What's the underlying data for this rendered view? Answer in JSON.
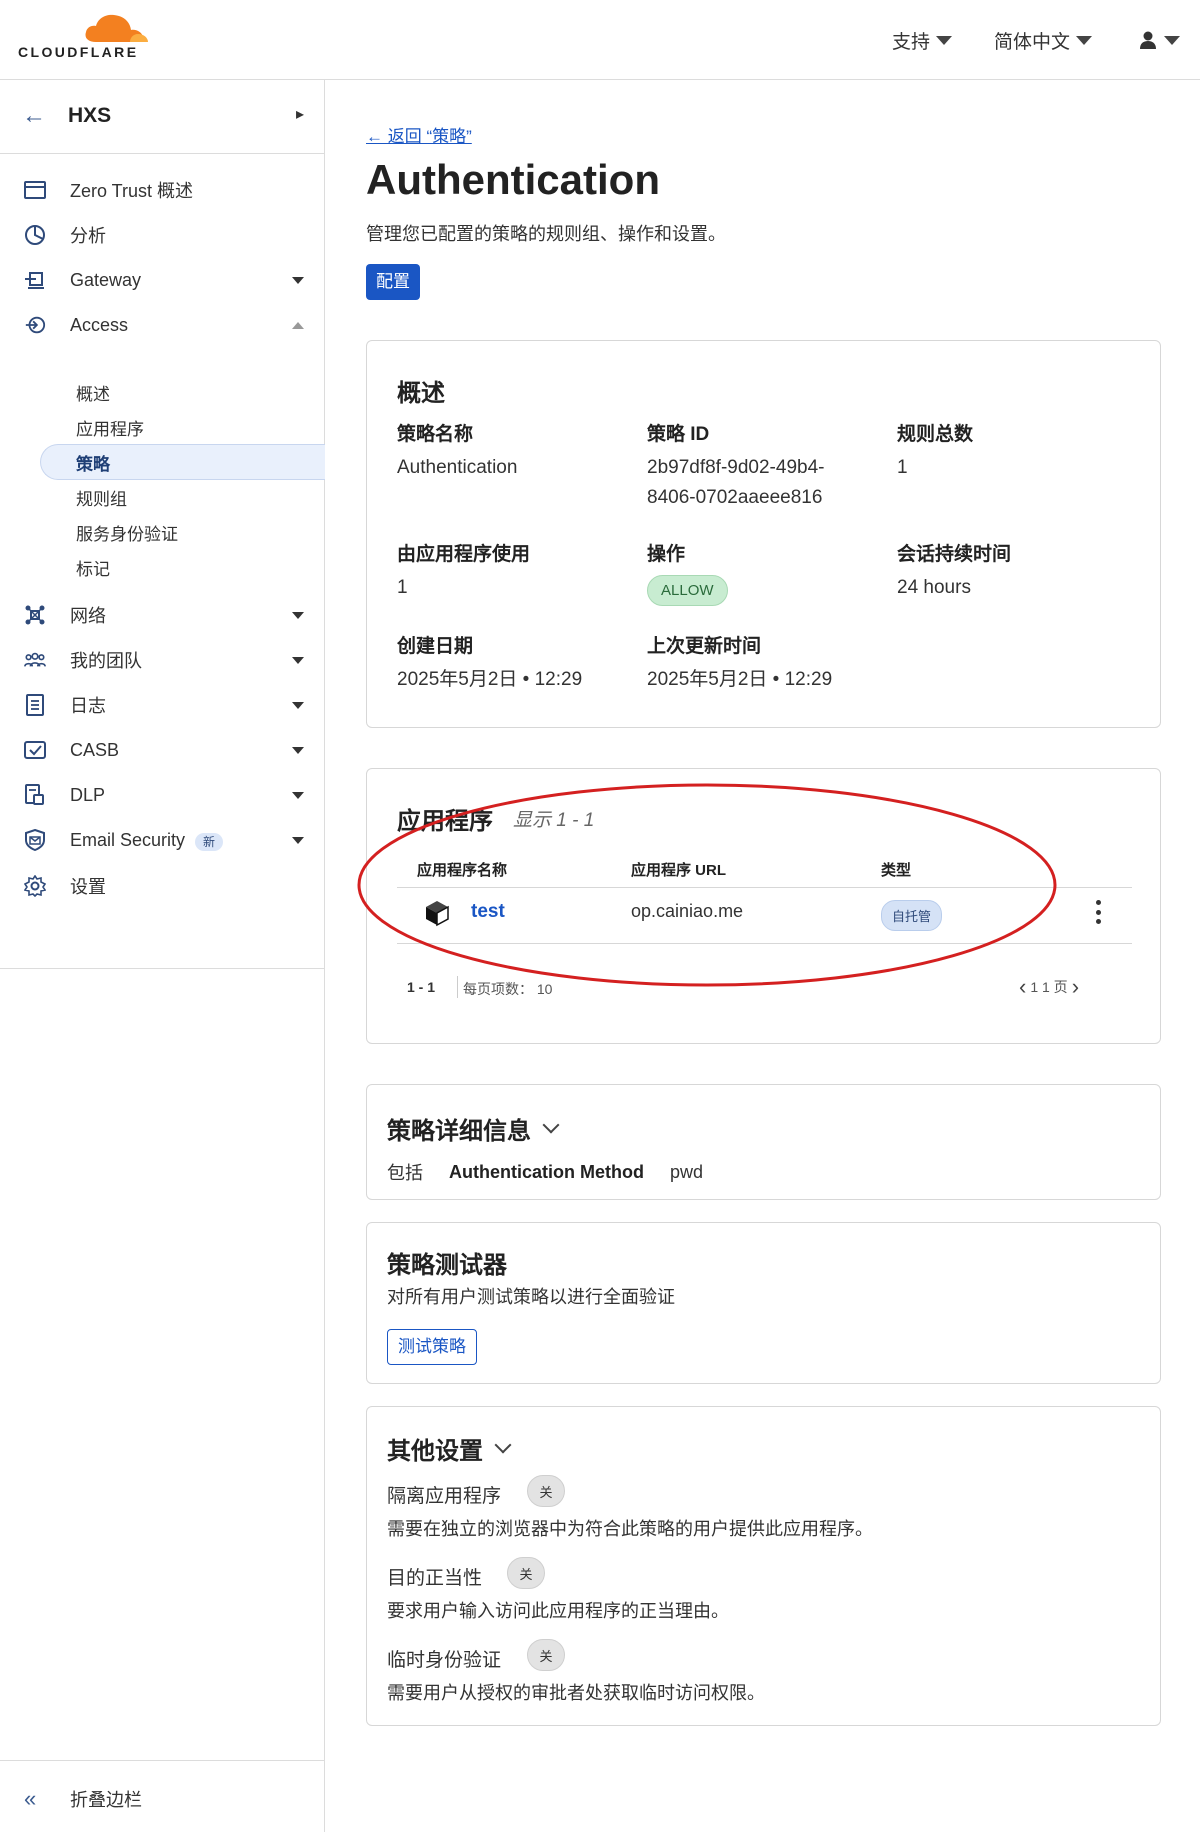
{
  "header": {
    "brand": "CLOUDFLARE",
    "support_label": "支持",
    "language_label": "简体中文"
  },
  "sidebar": {
    "account_name": "HXS",
    "items": [
      {
        "label": "Zero Trust 概述",
        "icon": "browser-window-icon"
      },
      {
        "label": "分析",
        "icon": "pie-chart-icon"
      },
      {
        "label": "Gateway",
        "icon": "gateway-icon"
      },
      {
        "label": "Access",
        "icon": "access-icon"
      },
      {
        "label": "网络",
        "icon": "network-icon"
      },
      {
        "label": "我的团队",
        "icon": "team-icon"
      },
      {
        "label": "日志",
        "icon": "logs-icon"
      },
      {
        "label": "CASB",
        "icon": "casb-icon"
      },
      {
        "label": "DLP",
        "icon": "dlp-icon"
      },
      {
        "label": "Email Security",
        "icon": "email-security-icon",
        "badge": "新"
      },
      {
        "label": "设置",
        "icon": "gear-icon"
      }
    ],
    "access_sub": [
      "概述",
      "应用程序",
      "策略",
      "规则组",
      "服务身份验证",
      "标记"
    ],
    "collapse_label": "折叠边栏"
  },
  "main": {
    "back_link": "← 返回 “策略”",
    "title": "Authentication",
    "description": "管理您已配置的策略的规则组、操作和设置。",
    "configure_button": "配置",
    "overview": {
      "heading": "概述",
      "policy_name_label": "策略名称",
      "policy_name": "Authentication",
      "policy_id_label": "策略 ID",
      "policy_id_line1": "2b97df8f-9d02-49b4-",
      "policy_id_line2": "8406-0702aaeee816",
      "rule_count_label": "规则总数",
      "rule_count": "1",
      "used_by_label": "由应用程序使用",
      "used_by": "1",
      "action_label": "操作",
      "action": "ALLOW",
      "session_label": "会话持续时间",
      "session": "24 hours",
      "created_label": "创建日期",
      "created": "2025年5月2日 • 12:29",
      "updated_label": "上次更新时间",
      "updated": "2025年5月2日 • 12:29"
    },
    "apps": {
      "heading": "应用程序",
      "showing": "显示 1 - 1",
      "columns": [
        "应用程序名称",
        "应用程序 URL",
        "类型"
      ],
      "rows": [
        {
          "name": "test",
          "url": "op.cainiao.me",
          "type": "自托管"
        }
      ],
      "range": "1 - 1",
      "per_page": "每页项数： 10",
      "page_info": "1 1 页"
    },
    "details": {
      "heading": "策略详细信息",
      "include_label": "包括",
      "method_label": "Authentication Method",
      "method_value": "pwd"
    },
    "tester": {
      "heading": "策略测试器",
      "description": "对所有用户测试策略以进行全面验证",
      "button": "测试策略"
    },
    "other": {
      "heading": "其他设置",
      "settings": [
        {
          "label": "隔离应用程序",
          "state": "关",
          "desc": "需要在独立的浏览器中为符合此策略的用户提供此应用程序。"
        },
        {
          "label": "目的正当性",
          "state": "关",
          "desc": "要求用户输入访问此应用程序的正当理由。"
        },
        {
          "label": "临时身份验证",
          "state": "关",
          "desc": "需要用户从授权的审批者处获取临时访问权限。"
        }
      ]
    }
  },
  "colors": {
    "accent": "#1a56c4",
    "annotation": "#d42020",
    "cloud_orange": "#f38020"
  }
}
